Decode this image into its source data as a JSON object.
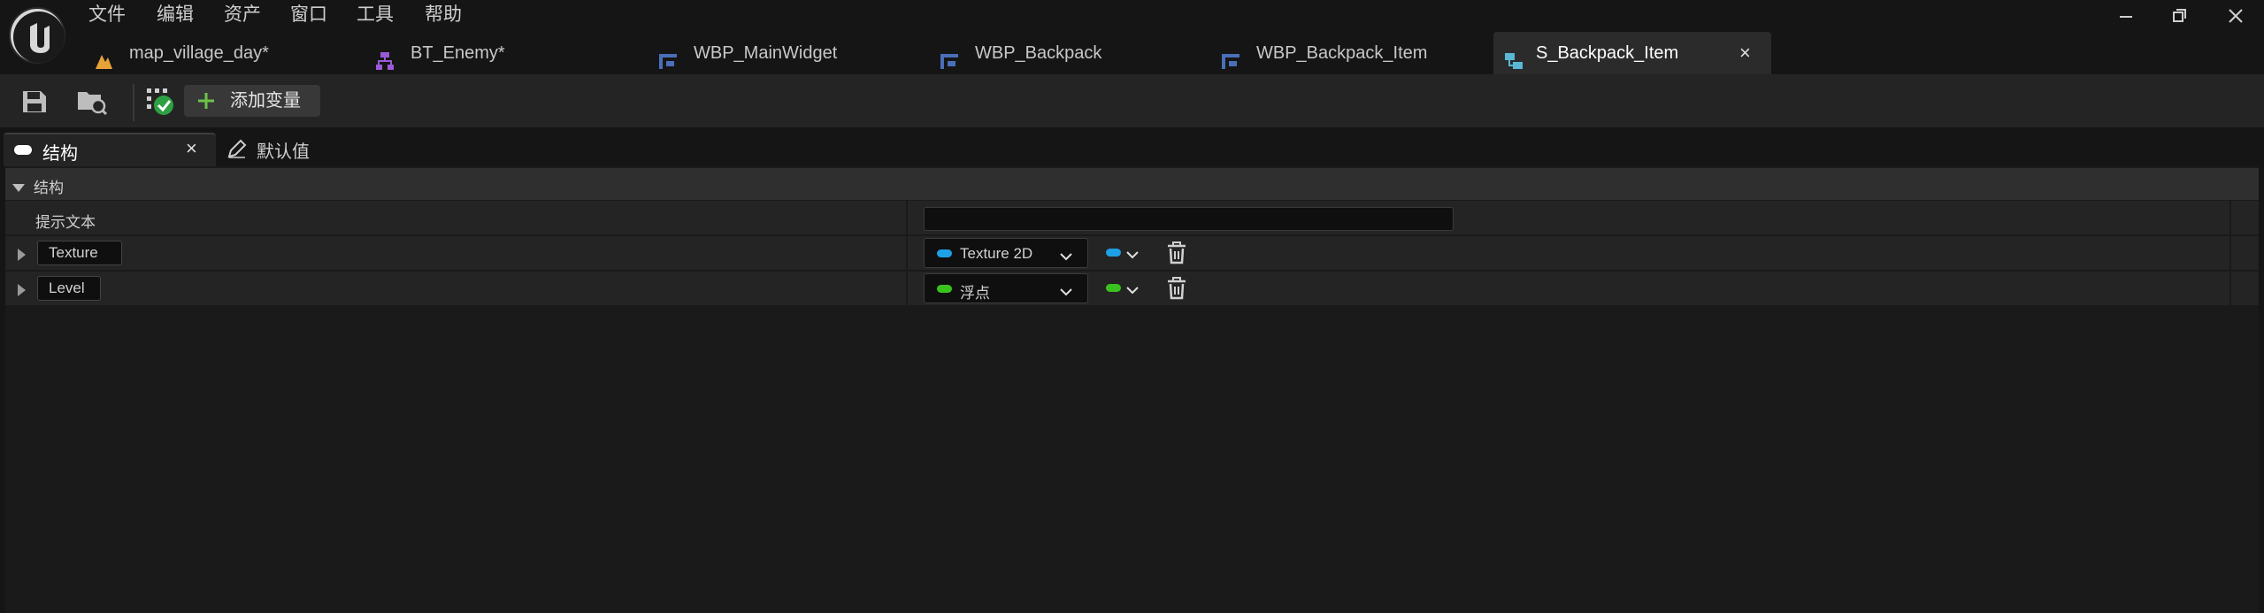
{
  "menu": [
    "文件",
    "编辑",
    "资产",
    "窗口",
    "工具",
    "帮助"
  ],
  "tabs": [
    {
      "label": "map_village_day*",
      "icon": "level-icon",
      "color": "#e8a23a"
    },
    {
      "label": "BT_Enemy*",
      "icon": "behavior-tree-icon",
      "color": "#9a5ad6"
    },
    {
      "label": "WBP_MainWidget",
      "icon": "widget-blueprint-icon",
      "color": "#4a6fb8"
    },
    {
      "label": "WBP_Backpack",
      "icon": "widget-blueprint-icon",
      "color": "#4a6fb8"
    },
    {
      "label": "WBP_Backpack_Item",
      "icon": "widget-blueprint-icon",
      "color": "#4a6fb8"
    },
    {
      "label": "S_Backpack_Item",
      "icon": "struct-icon",
      "color": "#5ab8d6"
    }
  ],
  "tab_close": "×",
  "toolbar": {
    "add_variable_label": "添加变量",
    "add_icon_color": "#6cc24a"
  },
  "panel_tabs": {
    "structure": "结构",
    "defaults": "默认值",
    "close": "×"
  },
  "category": {
    "label": "结构"
  },
  "tooltip_row": {
    "label": "提示文本",
    "value": ""
  },
  "members": [
    {
      "name": "Texture",
      "type": "Texture 2D",
      "type_color": "#1ea0e6"
    },
    {
      "name": "Level",
      "type": "浮点",
      "type_color": "#39c21e"
    }
  ],
  "colors": {
    "accent": "#5ab8d6",
    "background": "#151515",
    "panel": "#242424"
  }
}
